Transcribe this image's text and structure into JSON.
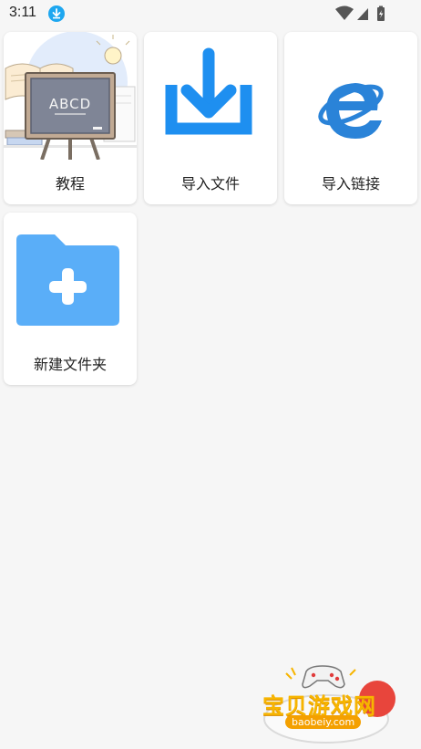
{
  "status_bar": {
    "time": "3:11"
  },
  "cards": [
    {
      "label": "教程",
      "icon": "tutorial-blackboard-icon",
      "board_text": "ABCD"
    },
    {
      "label": "导入文件",
      "icon": "import-file-icon"
    },
    {
      "label": "导入链接",
      "icon": "internet-explorer-icon"
    },
    {
      "label": "新建文件夹",
      "icon": "new-folder-icon"
    }
  ],
  "colors": {
    "accent": "#1e8ff0",
    "folder": "#5aaef8",
    "ie": "#2a83d8"
  },
  "watermark": {
    "text": "宝贝游戏网",
    "url": "baobeiy.com"
  }
}
